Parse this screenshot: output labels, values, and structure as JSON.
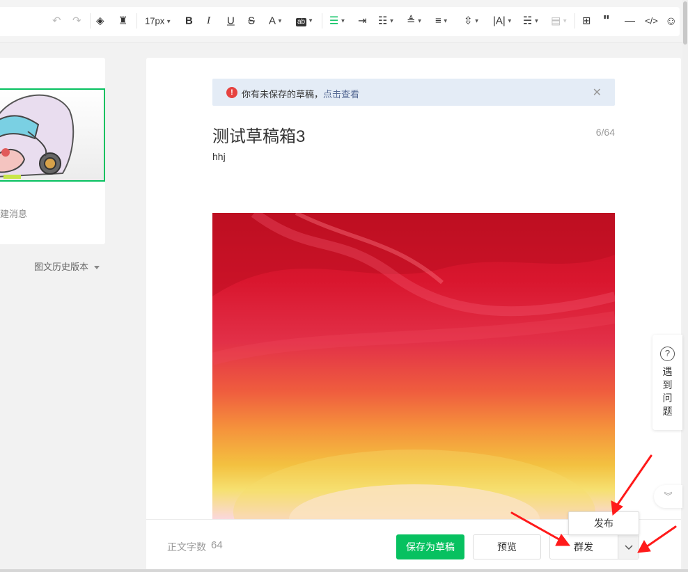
{
  "toolbar": {
    "font_size": "17px",
    "colors": {
      "active": "#07c160",
      "disabled": "#bbbbbb"
    }
  },
  "left_panel": {
    "caption": "建消息",
    "history_label": "图文历史版本"
  },
  "editor": {
    "notice_text": "你有未保存的草稿，",
    "notice_link": "点击查看",
    "title": "测试草稿箱3",
    "title_count": "6/64",
    "author": "hhj"
  },
  "help": {
    "label": "遇到问题"
  },
  "bottom": {
    "word_count_label": "正文字数",
    "word_count_value": "64",
    "save_draft": "保存为草稿",
    "preview": "预览",
    "mass_send": "群发",
    "publish": "发布"
  },
  "colors": {
    "brand_green": "#07c160",
    "link": "#576b95",
    "warn_red": "#e64340",
    "annotation_red": "#ff1a1a"
  }
}
